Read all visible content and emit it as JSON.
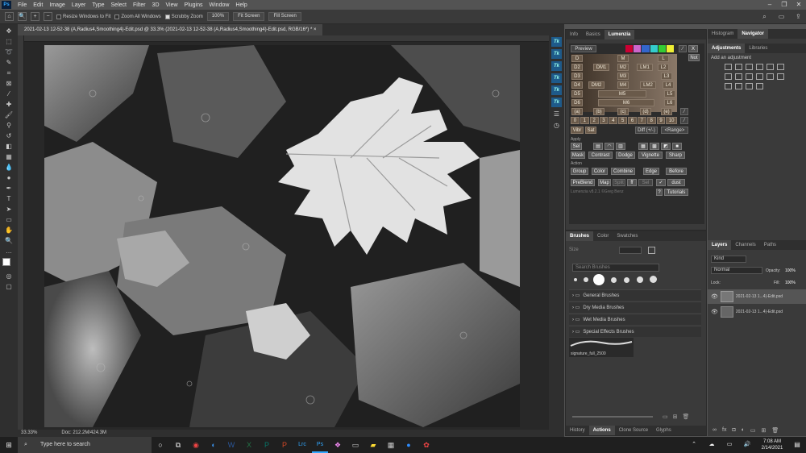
{
  "menu": [
    "File",
    "Edit",
    "Image",
    "Layer",
    "Type",
    "Select",
    "Filter",
    "3D",
    "View",
    "Plugins",
    "Window",
    "Help"
  ],
  "options": {
    "resize": "Resize Windows to Fit",
    "zoom_all": "Zoom All Windows",
    "scrubby": "Scrubby Zoom",
    "pct": "100%",
    "fit": "Fit Screen",
    "fill": "Fill Screen"
  },
  "doc_tab": "2021-02-13 12-52-38 (A,Radius4,Smoothing4)-Edit.psd @ 33.3% (2021-02-13 12-52-38 (A,Radius4,Smoothing4)-Edit.psd, RGB/16*) *",
  "status": {
    "zoom": "33.33%",
    "doc": "Doc: 212.2M/424.3M"
  },
  "left_tabs": [
    "Info",
    "Basics",
    "Lumenzia"
  ],
  "lum": {
    "preview": "Preview",
    "x": "X",
    "not": "Not",
    "rows": [
      [
        "D",
        "M",
        "L"
      ],
      [
        "D2",
        "DM1",
        "M2",
        "LM1",
        "L2"
      ],
      [
        "D3",
        "M3",
        "L3"
      ],
      [
        "D4",
        "DM2",
        "M4",
        "LM2",
        "L4"
      ],
      [
        "D5",
        "M5",
        "L5"
      ],
      [
        "D6",
        "M6",
        "L6"
      ]
    ],
    "zone": [
      "(a)",
      "(b)",
      "(c)",
      "(d)",
      "(e)"
    ],
    "nums": [
      "0",
      "1",
      "2",
      "3",
      "4",
      "5",
      "6",
      "7",
      "8",
      "9",
      "10"
    ],
    "vibr": "Vibr",
    "sat": "Sat",
    "diff": "Diff (+/-)",
    "range": "<Range>",
    "apply": "Apply",
    "sel": "Sel",
    "mask": "Mask",
    "contrast": "Contrast",
    "dodge": "Dodge",
    "vignette": "Vignette",
    "sharp": "Sharp",
    "action": "Action",
    "group": "Group",
    "color": "Color",
    "combine": "Combine",
    "edge": "Edge",
    "before": "Before",
    "preblend": "PreBlend",
    "map": "Map",
    "split": "Split",
    "ff": "ff",
    "sel2": "Sel",
    "dust": "dust",
    "version": "Lumenzia v8.2.1 ©Greg Benz",
    "help": "?",
    "tutorials": "Tutorials"
  },
  "brush_tabs": [
    "Brushes",
    "Color",
    "Swatches"
  ],
  "brush": {
    "size": "Size",
    "search": "Search Brushes",
    "folders": [
      "General Brushes",
      "Dry Media Brushes",
      "Wet Media Brushes",
      "Special Effects Brushes"
    ],
    "sig": "signature_full_2500"
  },
  "bottom_tabs": [
    "History",
    "Actions",
    "Clone Source",
    "Glyphs"
  ],
  "nav_tabs": [
    "Histogram",
    "Navigator"
  ],
  "adj_tabs": [
    "Adjustments",
    "Libraries"
  ],
  "adj_label": "Add an adjustment",
  "layer_tabs": [
    "Layers",
    "Channels",
    "Paths"
  ],
  "layers": {
    "kind": "Kind",
    "blend": "Normal",
    "opacity_l": "Opacity:",
    "opacity": "100%",
    "lock": "Lock:",
    "fill_l": "Fill:",
    "fill": "100%",
    "items": [
      "2021-02-13 1...4)-Edit.psd",
      "2021-02-13 1...4)-Edit.psd"
    ]
  },
  "taskbar": {
    "search": "Type here to search",
    "time": "7:08 AM",
    "date": "2/14/2021",
    "lrc": "Lrc",
    "ps": "Ps"
  },
  "colors": {
    "accent": "#31a8ff",
    "lum_btn": "#6a5a4a"
  }
}
